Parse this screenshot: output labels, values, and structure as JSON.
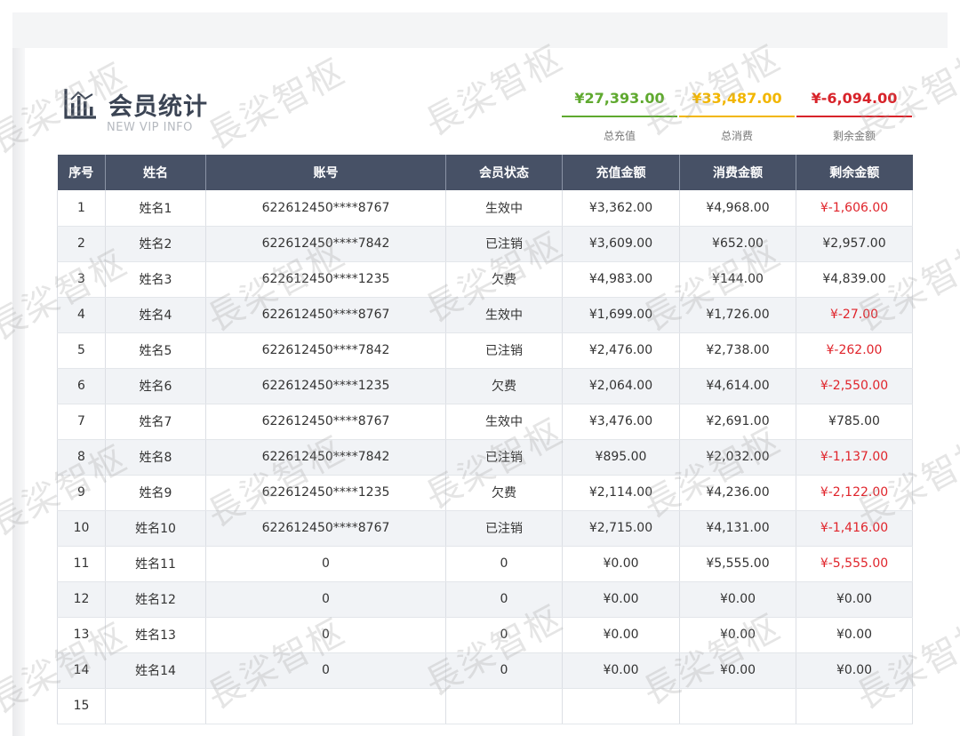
{
  "header": {
    "title": "会员统计",
    "subtitle": "NEW VIP  INFO"
  },
  "summary": {
    "total_charge": {
      "value": "¥27,393.00",
      "label": "总充值",
      "color": "#5fa92f"
    },
    "total_spend": {
      "value": "¥33,487.00",
      "label": "总消费",
      "color": "#f2b600"
    },
    "remaining": {
      "value": "¥-6,094.00",
      "label": "剩余金额",
      "color": "#d8232a"
    }
  },
  "table": {
    "columns": [
      "序号",
      "姓名",
      "账号",
      "会员状态",
      "充值金额",
      "消费金额",
      "剩余金额"
    ],
    "rows": [
      [
        "1",
        "姓名1",
        "622612450****8767",
        "生效中",
        "¥3,362.00",
        "¥4,968.00",
        "¥-1,606.00"
      ],
      [
        "2",
        "姓名2",
        "622612450****7842",
        "已注销",
        "¥3,609.00",
        "¥652.00",
        "¥2,957.00"
      ],
      [
        "3",
        "姓名3",
        "622612450****1235",
        "欠费",
        "¥4,983.00",
        "¥144.00",
        "¥4,839.00"
      ],
      [
        "4",
        "姓名4",
        "622612450****8767",
        "生效中",
        "¥1,699.00",
        "¥1,726.00",
        "¥-27.00"
      ],
      [
        "5",
        "姓名5",
        "622612450****7842",
        "已注销",
        "¥2,476.00",
        "¥2,738.00",
        "¥-262.00"
      ],
      [
        "6",
        "姓名6",
        "622612450****1235",
        "欠费",
        "¥2,064.00",
        "¥4,614.00",
        "¥-2,550.00"
      ],
      [
        "7",
        "姓名7",
        "622612450****8767",
        "生效中",
        "¥3,476.00",
        "¥2,691.00",
        "¥785.00"
      ],
      [
        "8",
        "姓名8",
        "622612450****7842",
        "已注销",
        "¥895.00",
        "¥2,032.00",
        "¥-1,137.00"
      ],
      [
        "9",
        "姓名9",
        "622612450****1235",
        "欠费",
        "¥2,114.00",
        "¥4,236.00",
        "¥-2,122.00"
      ],
      [
        "10",
        "姓名10",
        "622612450****8767",
        "已注销",
        "¥2,715.00",
        "¥4,131.00",
        "¥-1,416.00"
      ],
      [
        "11",
        "姓名11",
        "0",
        "0",
        "¥0.00",
        "¥5,555.00",
        "¥-5,555.00"
      ],
      [
        "12",
        "姓名12",
        "0",
        "0",
        "¥0.00",
        "¥0.00",
        "¥0.00"
      ],
      [
        "13",
        "姓名13",
        "0",
        "0",
        "¥0.00",
        "¥0.00",
        "¥0.00"
      ],
      [
        "14",
        "姓名14",
        "0",
        "0",
        "¥0.00",
        "¥0.00",
        "¥0.00"
      ],
      [
        "15",
        "",
        "",
        "",
        "",
        "",
        ""
      ]
    ]
  },
  "watermark": "長桬智枢",
  "colors": {
    "header_bg": "#475166",
    "row_alt": "#f1f3f6",
    "negative": "#e0242b"
  },
  "icons": {
    "logo": "bar-chart-icon"
  }
}
